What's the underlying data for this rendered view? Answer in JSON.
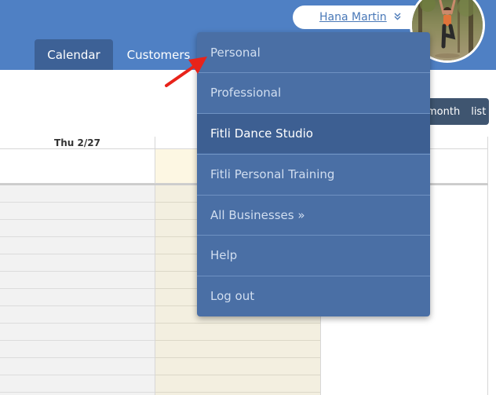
{
  "header": {
    "tabs": [
      {
        "label": "Calendar",
        "active": true
      },
      {
        "label": "Customers",
        "active": false
      }
    ],
    "user": {
      "name": "Hana Martin",
      "chevron": "»"
    }
  },
  "view_toggle": {
    "month_label": "month",
    "list_label": "list"
  },
  "calendar": {
    "day_header": "Thu 2/27"
  },
  "dropdown": {
    "items": [
      {
        "label": "Personal"
      },
      {
        "label": "Professional"
      },
      {
        "label": "Fitli Dance Studio",
        "active": true
      },
      {
        "label": "Fitli Personal Training"
      },
      {
        "label": "All Businesses »"
      },
      {
        "label": "Help"
      },
      {
        "label": "Log out"
      }
    ]
  },
  "colors": {
    "header_bg": "#4f80c4",
    "tab_active_bg": "#3d6196",
    "menu_bg": "#4a6fa5",
    "menu_active_bg": "#3d5f92",
    "arrow": "#e8231a"
  },
  "icons": {
    "arrow": "red-arrow-pointer-icon",
    "chevron": "double-chevron-down-icon"
  }
}
